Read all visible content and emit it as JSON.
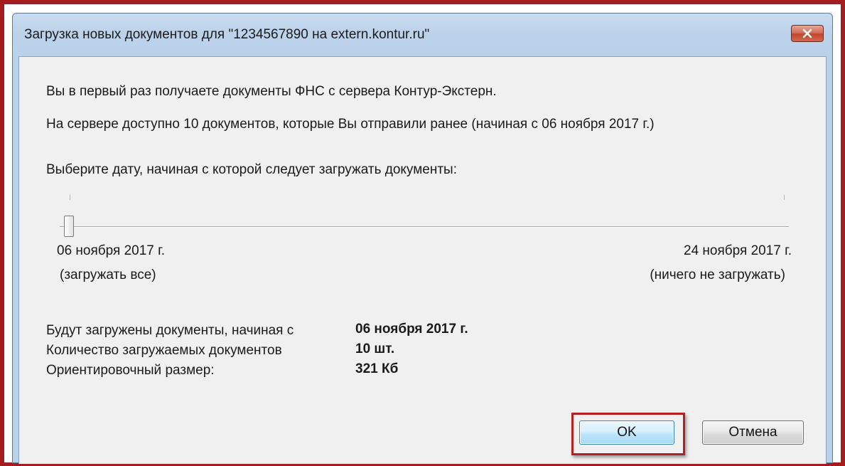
{
  "window": {
    "title": "Загрузка новых документов для \"1234567890 на extern.kontur.ru\"",
    "close_label": "✕"
  },
  "intro": {
    "line1": "Вы в первый раз получаете документы ФНС с сервера Контур-Экстерн.",
    "line2": "На сервере доступно 10 документов, которые Вы отправили ранее (начиная с 06 ноября 2017 г.)"
  },
  "slider": {
    "prompt": "Выберите дату, начиная с которой следует загружать документы:",
    "value_fraction": 0,
    "left_date": "06 ноября 2017 г.",
    "left_note": "(загружать все)",
    "right_date": "24 ноября 2017 г.",
    "right_note": "(ничего не загружать)"
  },
  "summary": {
    "rows": [
      {
        "label": "Будут загружены документы, начиная с",
        "value": "06 ноября 2017 г."
      },
      {
        "label": "Количество загружаемых документов",
        "value": "10 шт."
      },
      {
        "label": "Ориентировочный размер:",
        "value": "321 Кб"
      }
    ]
  },
  "buttons": {
    "ok": "OK",
    "cancel": "Отмена"
  },
  "colors": {
    "highlight": "#b51e22",
    "frame": "#a51c1f",
    "dialog_bg": "#f0f0f0"
  }
}
